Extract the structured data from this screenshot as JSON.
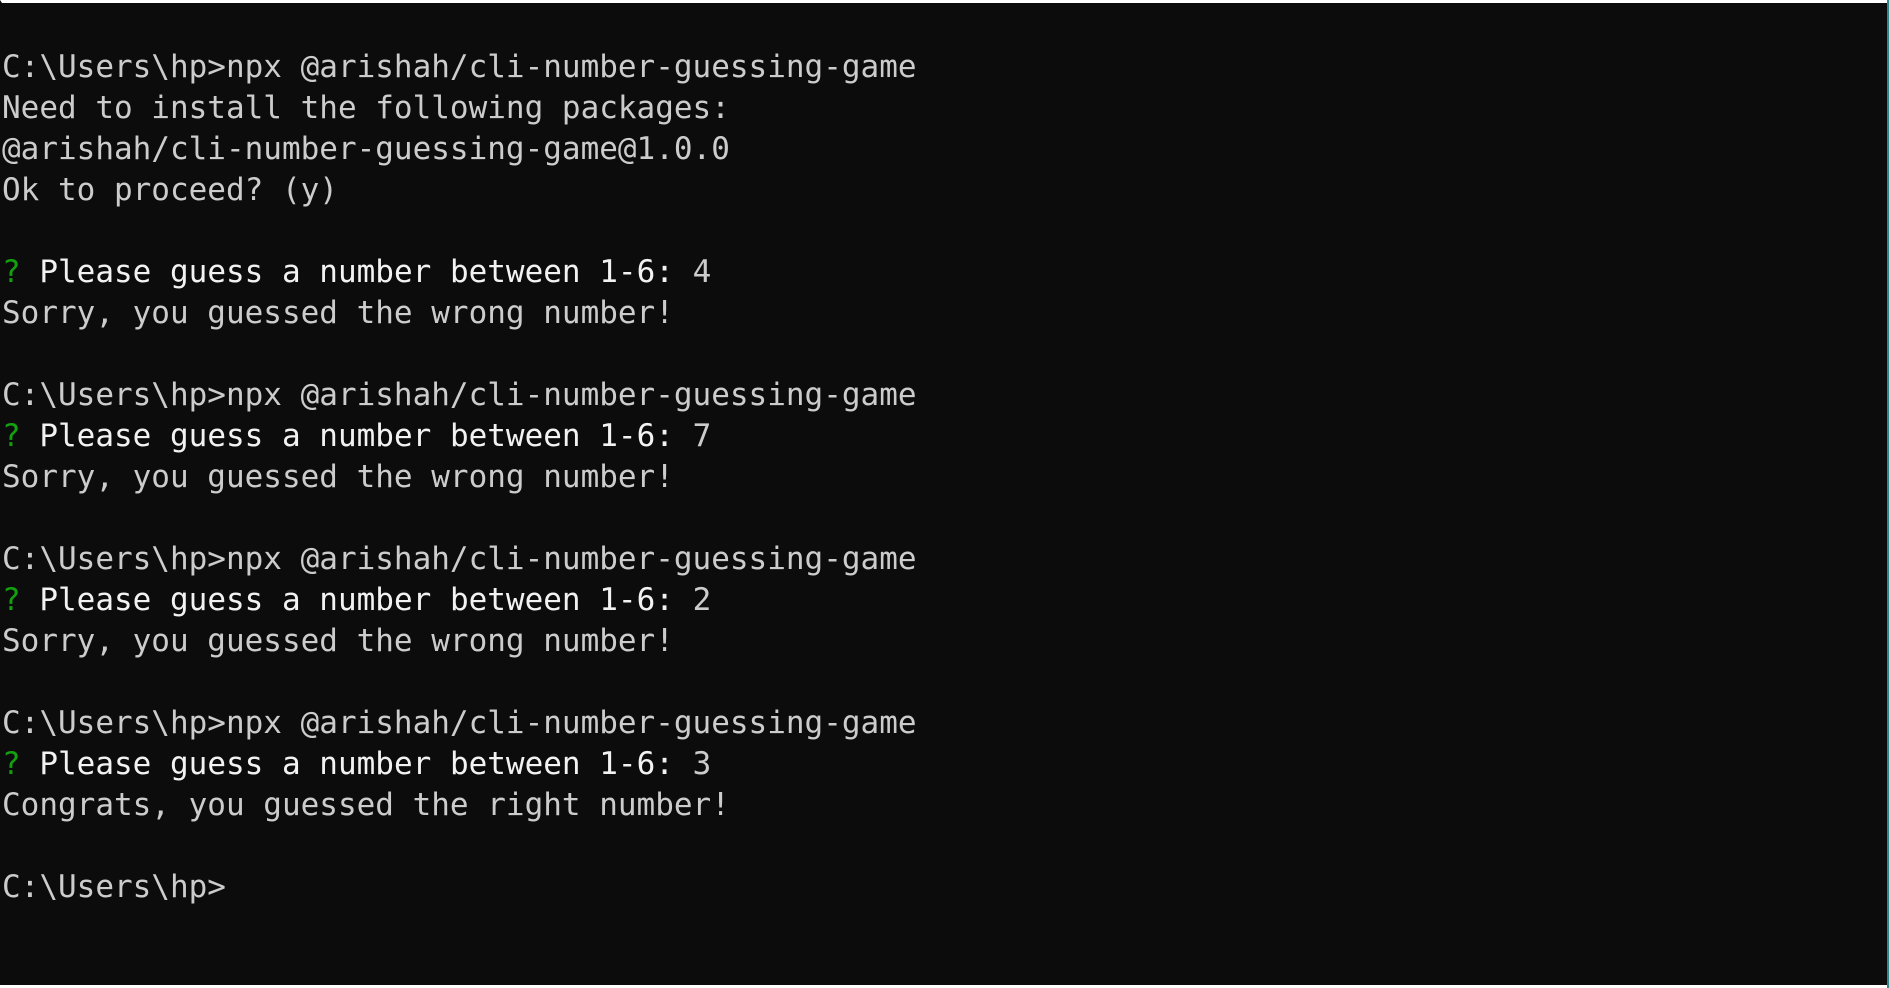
{
  "terminal": {
    "colors": {
      "background": "#0c0c0c",
      "text": "#cccccc",
      "bright_text": "#f2f2f2",
      "prompt_marker": "#13a10e"
    },
    "lines": [
      "C:\\Users\\hp>npx @arishah/cli-number-guessing-game",
      "Need to install the following packages:",
      "@arishah/cli-number-guessing-game@1.0.0",
      "Ok to proceed? (y)",
      "",
      {
        "marker": "?",
        "question": "Please guess a number between 1-6:",
        "answer": "4"
      },
      "Sorry, you guessed the wrong number!",
      "",
      "C:\\Users\\hp>npx @arishah/cli-number-guessing-game",
      {
        "marker": "?",
        "question": "Please guess a number between 1-6:",
        "answer": "7"
      },
      "Sorry, you guessed the wrong number!",
      "",
      "C:\\Users\\hp>npx @arishah/cli-number-guessing-game",
      {
        "marker": "?",
        "question": "Please guess a number between 1-6:",
        "answer": "2"
      },
      "Sorry, you guessed the wrong number!",
      "",
      "C:\\Users\\hp>npx @arishah/cli-number-guessing-game",
      {
        "marker": "?",
        "question": "Please guess a number between 1-6:",
        "answer": "3"
      },
      "Congrats, you guessed the right number!",
      "",
      "C:\\Users\\hp>"
    ]
  }
}
